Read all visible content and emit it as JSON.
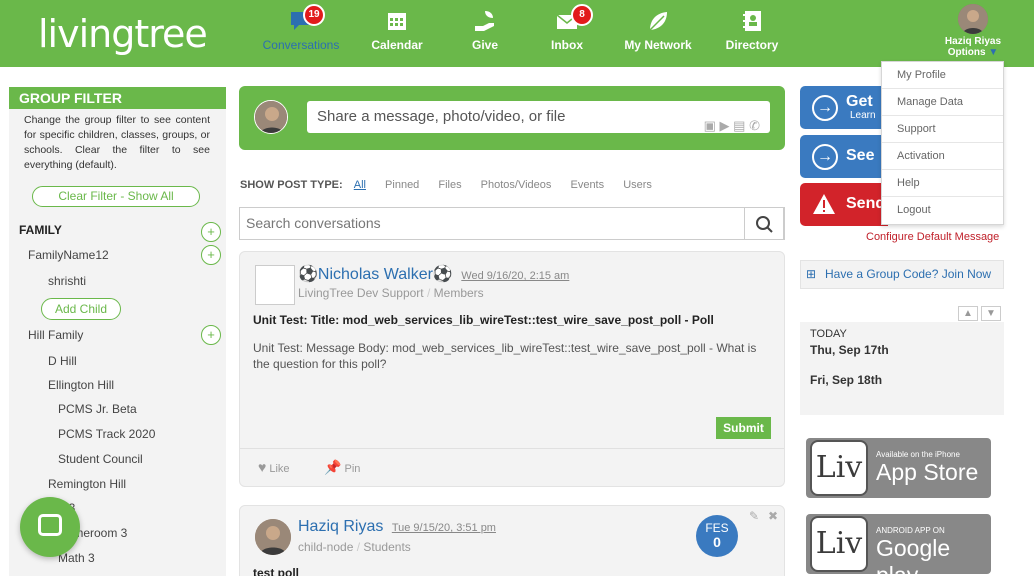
{
  "brand": {
    "logo_text": "livingtree"
  },
  "nav": [
    {
      "label": "Conversations",
      "badge": "19",
      "icon": "chat-bubble-icon"
    },
    {
      "label": "Calendar",
      "badge": "",
      "icon": "calendar-icon"
    },
    {
      "label": "Give",
      "badge": "",
      "icon": "give-hand-icon"
    },
    {
      "label": "Inbox",
      "badge": "8",
      "icon": "envelope-icon"
    },
    {
      "label": "My Network",
      "badge": "",
      "icon": "network-leaf-icon"
    },
    {
      "label": "Directory",
      "badge": "",
      "icon": "directory-icon"
    }
  ],
  "user": {
    "name": "Haziq Riyas",
    "options_label": "Options"
  },
  "user_menu": [
    "My Profile",
    "Manage Data",
    "Support",
    "Activation",
    "Help",
    "Logout"
  ],
  "sidebar": {
    "title": "GROUP FILTER",
    "description": "Change the group filter to see content for specific children, classes, groups, or schools. Clear the filter to see everything (default).",
    "clear_label": "Clear Filter - Show All",
    "family_heading": "FAMILY",
    "add_child_label": "Add Child",
    "items": {
      "family_name": "FamilyName12",
      "child": "shrishti",
      "hill_family": "Hill Family",
      "d_hill": "D Hill",
      "ellington": "Ellington Hill",
      "pcms_beta": "PCMS Jr. Beta",
      "pcms_track": "PCMS Track 2020",
      "student_council": "Student Council",
      "remington": "Remington Hill",
      "a3": "A 3",
      "homeroom3": "Homeroom 3",
      "math3": "Math 3"
    }
  },
  "share": {
    "placeholder": "Share a message, photo/video, or file"
  },
  "post_types": {
    "label": "SHOW POST TYPE:",
    "options": [
      "All",
      "Pinned",
      "Files",
      "Photos/Videos",
      "Events",
      "Users"
    ],
    "selected": "All"
  },
  "search": {
    "placeholder": "Search conversations"
  },
  "posts": [
    {
      "author": "Nicholas Walker",
      "date": "Wed 9/16/20, 2:15 am",
      "group": "LivingTree Dev Support",
      "role": "Members",
      "title": "Unit Test: Title: mod_web_services_lib_wireTest::test_wire_save_post_poll - Poll",
      "body": "Unit Test: Message Body: mod_web_services_lib_wireTest::test_wire_save_post_poll - What is the question for this poll?",
      "submit_label": "Submit",
      "like_label": "Like",
      "pin_label": "Pin"
    },
    {
      "author": "Haziq Riyas",
      "date": "Tue 9/15/20, 3:51 pm",
      "group": "child-node",
      "role": "Students",
      "title": "test poll",
      "fes_label": "FES",
      "fes_count": "0"
    }
  ],
  "right": {
    "btn1": {
      "title": "Get",
      "subtitle": "Learn",
      "color": "#3a7ac0"
    },
    "btn2": {
      "title": "See",
      "color": "#3a7ac0"
    },
    "btn3": {
      "title": "Send",
      "color": "#d2232a"
    },
    "configure_label": "Configure Default Message",
    "group_code_label": "Have a Group Code? Join Now",
    "calendar": {
      "today_label": "TODAY",
      "day1": "Thu, Sep 17th",
      "day2": "Fri, Sep 18th"
    },
    "app_store": {
      "small": "Available on the iPhone",
      "big": "App Store"
    },
    "google_play": {
      "small": "ANDROID APP ON",
      "big": "Google play"
    }
  },
  "colors": {
    "brand_green": "#6ab84a",
    "link_blue": "#2c6fb0",
    "alert_red": "#d2232a"
  }
}
